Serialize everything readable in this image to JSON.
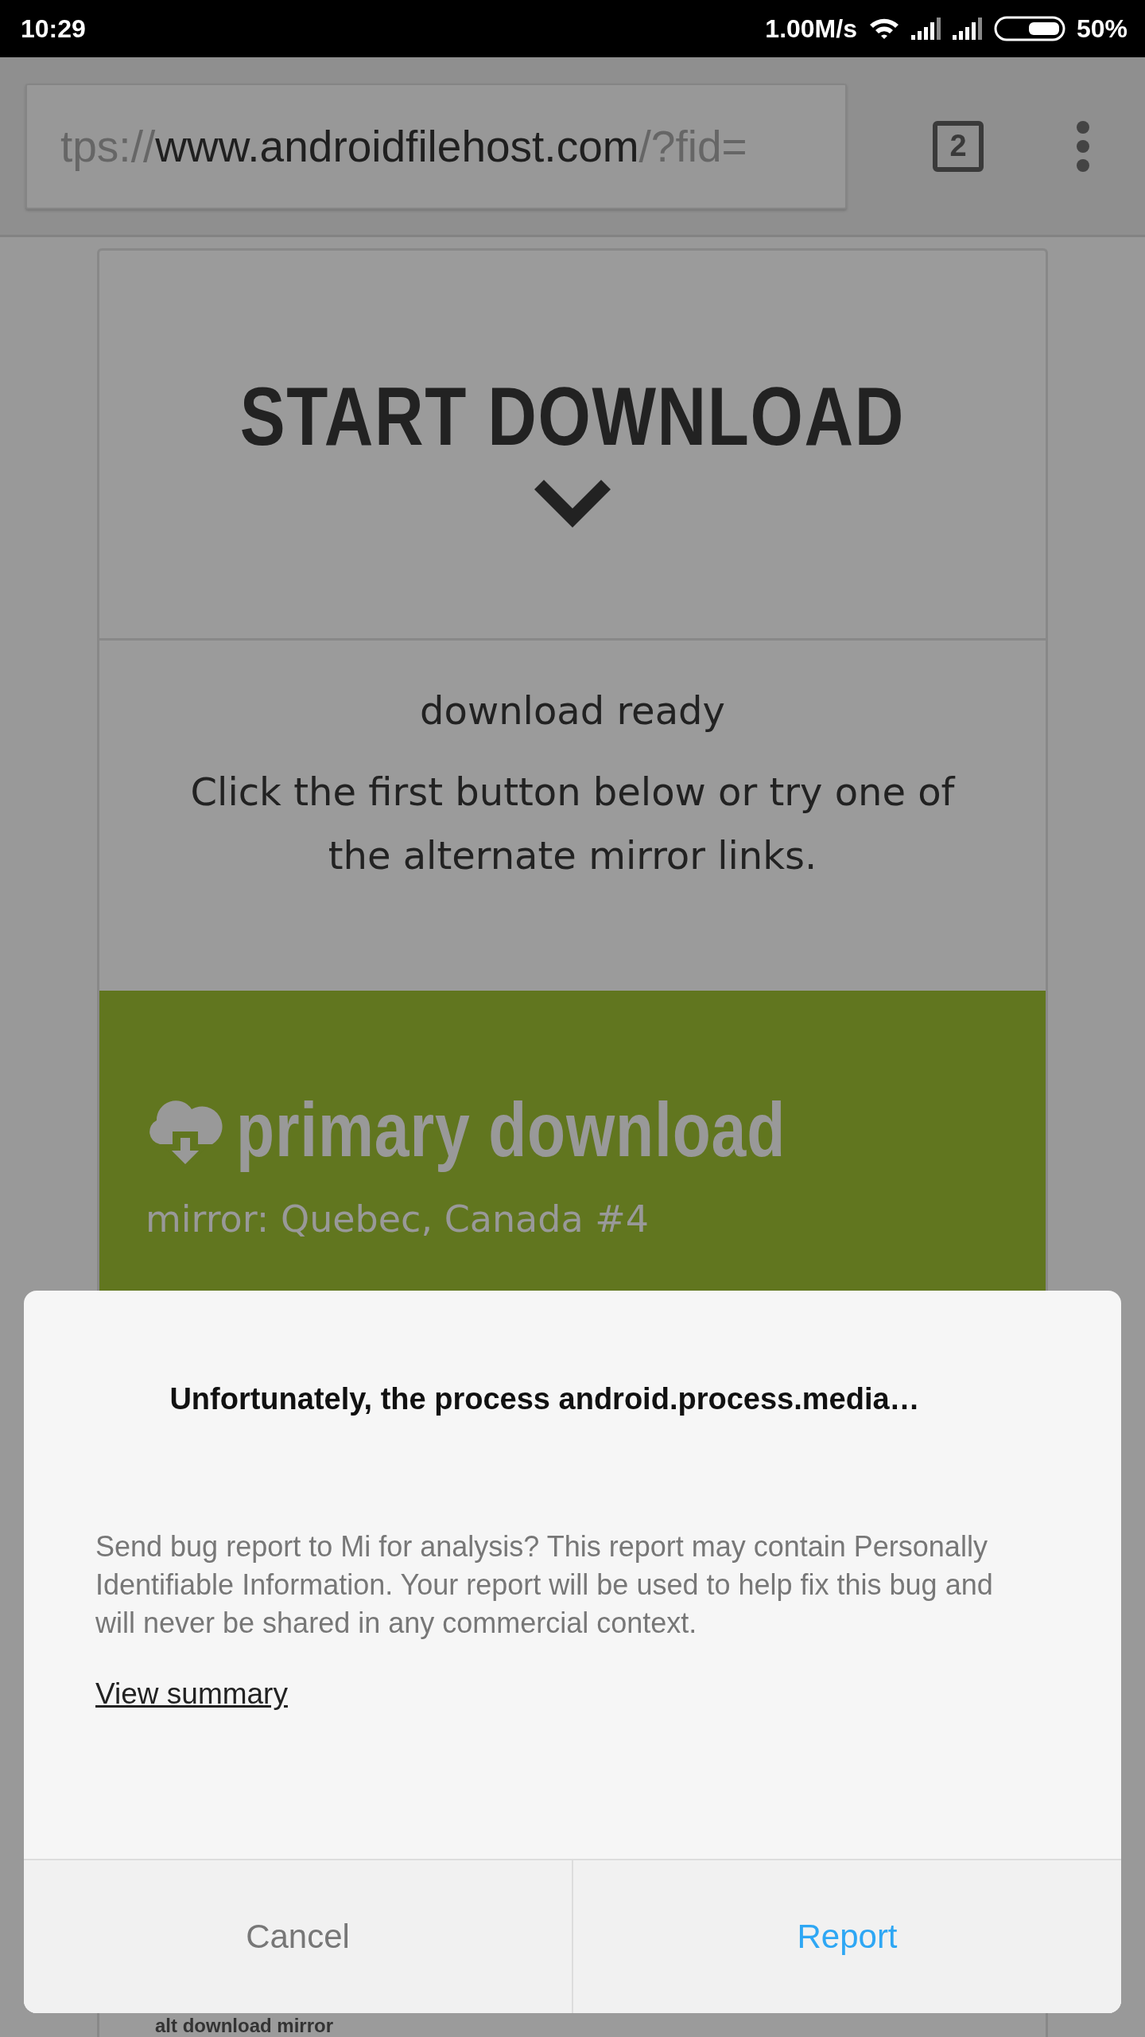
{
  "status_bar": {
    "time": "10:29",
    "net_speed": "1.00M/s",
    "battery": "50%"
  },
  "browser_toolbar": {
    "url": {
      "scheme": "tps://",
      "host": "www.androidfilehost.com",
      "path": "/?fid="
    },
    "tab_count": "2"
  },
  "page": {
    "title": "START DOWNLOAD",
    "status": "download ready",
    "message": "Click the first button below or try one of the alternate mirror links.",
    "primary_download": {
      "title": "primary download",
      "mirror": "mirror: Quebec, Canada #4"
    },
    "alt_download": {
      "title": "alt download mirror"
    }
  },
  "dialog": {
    "title": "Unfortunately, the process android.process.media…",
    "message": "Send bug report to Mi for analysis? This report may contain Personally Identifiable Information. Your report will be used to help fix this bug and will never be shared in any commercial context.",
    "link": "View summary",
    "buttons": [
      {
        "label": "Cancel",
        "kind": "cancel"
      },
      {
        "label": "Report",
        "kind": "primary"
      }
    ]
  }
}
